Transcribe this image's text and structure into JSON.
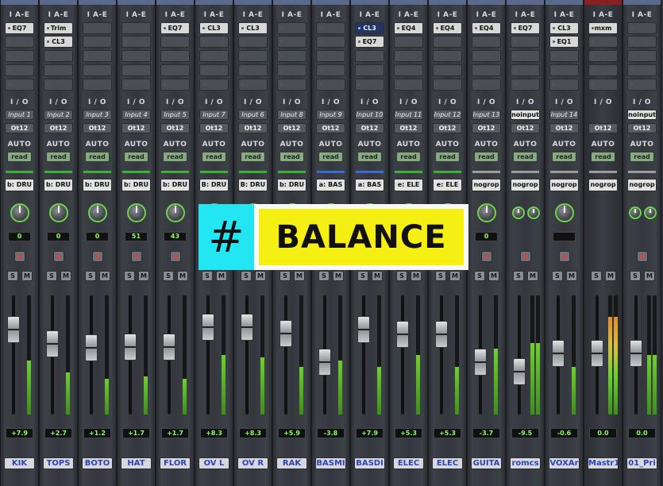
{
  "section_labels": {
    "inserts": "I A-E",
    "io": "I / O",
    "auto": "AUTO",
    "solo": "S",
    "mute": "M"
  },
  "colors": {
    "meter_green": "#6ecf2f",
    "name_blue": "#2c43b8",
    "read_green": "#88a984",
    "overlay_cyan": "#22e6f2",
    "overlay_yellow": "#f6ef14"
  },
  "overlay": {
    "hash": "#",
    "word": "BALANCE"
  },
  "strips": [
    {
      "name": "KIK",
      "inserts": [
        "EQ7"
      ],
      "input": "Input 1",
      "output": "Ot12",
      "auto": "read",
      "group": "b: DRU",
      "group_color": "#3fae3a",
      "pan": "0",
      "pan_type": "mono",
      "volume": "+7.9",
      "fader": 0.78,
      "meter": 0.45
    },
    {
      "name": "TOPS",
      "inserts": [
        "Trim",
        "CL3"
      ],
      "input": "Input 2",
      "output": "Ot12",
      "auto": "read",
      "group": "b: DRU",
      "group_color": "#3fae3a",
      "pan": "0",
      "pan_type": "mono",
      "volume": "+2.7",
      "fader": 0.62,
      "meter": 0.35
    },
    {
      "name": "BOTO",
      "inserts": [],
      "input": "Input 3",
      "output": "Ot12",
      "auto": "read",
      "group": "b: DRU",
      "group_color": "#3fae3a",
      "pan": "0",
      "pan_type": "mono",
      "volume": "+1.2",
      "fader": 0.58,
      "meter": 0.3
    },
    {
      "name": "HAT",
      "inserts": [],
      "input": "Input 4",
      "output": "Ot12",
      "auto": "read",
      "group": "b: DRU",
      "group_color": "#3fae3a",
      "pan": "51",
      "pan_type": "mono",
      "volume": "+1.7",
      "fader": 0.59,
      "meter": 0.32
    },
    {
      "name": "FLOR",
      "inserts": [
        "EQ7"
      ],
      "input": "Input 5",
      "output": "Ot12",
      "auto": "read",
      "group": "b: DRU",
      "group_color": "#3fae3a",
      "pan": "43",
      "pan_type": "mono",
      "volume": "+1.7",
      "fader": 0.59,
      "meter": 0.3
    },
    {
      "name": "OV L",
      "inserts": [
        "CL3"
      ],
      "input": "Input 7",
      "output": "Ot12",
      "auto": "read",
      "group": "B: DRU",
      "group_color": "#3fae3a",
      "pan": "",
      "pan_type": "mono",
      "volume": "+8.3",
      "fader": 0.8,
      "meter": 0.5
    },
    {
      "name": "OV R",
      "inserts": [
        "CL3"
      ],
      "input": "Input 6",
      "output": "Ot12",
      "auto": "read",
      "group": "B: DRU",
      "group_color": "#3fae3a",
      "pan": "",
      "pan_type": "mono",
      "volume": "+8.3",
      "fader": 0.8,
      "meter": 0.48
    },
    {
      "name": "RAK",
      "inserts": [],
      "input": "Input 8",
      "output": "Ot12",
      "auto": "read",
      "group": "b: DRU",
      "group_color": "#3fae3a",
      "pan": "",
      "pan_type": "mono",
      "volume": "+5.9",
      "fader": 0.73,
      "meter": 0.4
    },
    {
      "name": "BASMI",
      "inserts": [],
      "input": "Input 9",
      "output": "Ot12",
      "auto": "read",
      "group": "a: BAS",
      "group_color": "#3a6bd0",
      "pan": "",
      "pan_type": "mono",
      "volume": "-3.8",
      "fader": 0.42,
      "meter": 0.45
    },
    {
      "name": "BASDI",
      "inserts": [
        "CL3",
        "EQ7"
      ],
      "input": "Input 10",
      "output": "Ot12",
      "auto": "read",
      "group": "a: BAS",
      "group_color": "#3a6bd0",
      "pan": "",
      "pan_type": "mono",
      "volume": "+7.9",
      "fader": 0.78,
      "meter": 0.4,
      "first_insert_active": true
    },
    {
      "name": "ELEC",
      "inserts": [
        "EQ4"
      ],
      "input": "Input 11",
      "output": "Ot12",
      "auto": "read",
      "group": "e: ELE",
      "group_color": "#3fae3a",
      "pan": "",
      "pan_type": "mono",
      "volume": "+5.3",
      "fader": 0.72,
      "meter": 0.5
    },
    {
      "name": "ELEC",
      "inserts": [
        "EQ4"
      ],
      "input": "Input 12",
      "output": "Ot12",
      "auto": "read",
      "group": "e: ELE",
      "group_color": "#3fae3a",
      "pan": "",
      "pan_type": "mono",
      "volume": "+5.3",
      "fader": 0.72,
      "meter": 0.4
    },
    {
      "name": "GUITA",
      "inserts": [
        "EQ4"
      ],
      "input": "Input 13",
      "output": "Ot12",
      "auto": "read",
      "group": "nogrop",
      "group_color": "#9a9ca0",
      "pan": "0",
      "pan_type": "mono",
      "volume": "-3.7",
      "fader": 0.42,
      "meter": 0.55
    },
    {
      "name": "romcs",
      "inserts": [
        "EQ7"
      ],
      "input": "noinput",
      "output": "Ot12",
      "auto": "read",
      "group": "nogrop",
      "group_color": "#9a9ca0",
      "pan": "",
      "pan_type": "stereo",
      "volume": "-9.5",
      "fader": 0.32,
      "meter": 0.6
    },
    {
      "name": "VOXAr",
      "inserts": [
        "CL3",
        "EQ1"
      ],
      "input": "Input 14",
      "output": "Ot12",
      "auto": "read",
      "group": "nogrop",
      "group_color": "#9a9ca0",
      "pan": "",
      "pan_type": "mono",
      "volume": "-0.6",
      "fader": 0.52,
      "meter": 0.4
    },
    {
      "name": "Mastr1",
      "inserts": [
        "mxm"
      ],
      "input": "",
      "output": "Ot12",
      "auto": "read",
      "group": "nogrop",
      "group_color": "#9a9ca0",
      "pan": "",
      "pan_type": "none",
      "volume": "0.0",
      "fader": 0.52,
      "meter": 0.82,
      "master": true
    },
    {
      "name": "01_Pri",
      "inserts": [],
      "input": "noinput",
      "output": "Ot12",
      "auto": "read",
      "group": "nogrop",
      "group_color": "#9a9ca0",
      "pan": "",
      "pan_type": "stereo",
      "volume": "0.0",
      "fader": 0.52,
      "meter": 0.5
    }
  ]
}
